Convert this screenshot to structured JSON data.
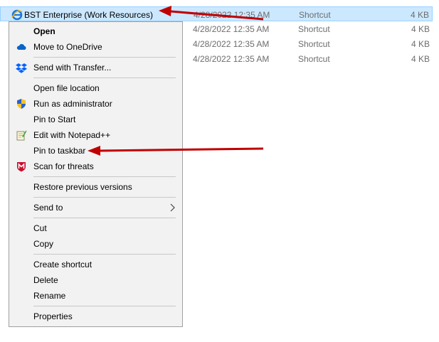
{
  "files": [
    {
      "name": "BST Enterprise (Work Resources)",
      "date": "4/28/2022 12:35 AM",
      "type": "Shortcut",
      "size": "4 KB"
    },
    {
      "name": "",
      "date": "4/28/2022 12:35 AM",
      "type": "Shortcut",
      "size": "4 KB"
    },
    {
      "name": "",
      "date": "4/28/2022 12:35 AM",
      "type": "Shortcut",
      "size": "4 KB"
    },
    {
      "name": "",
      "date": "4/28/2022 12:35 AM",
      "type": "Shortcut",
      "size": "4 KB"
    }
  ],
  "menu": {
    "open": "Open",
    "move_onedrive": "Move to OneDrive",
    "send_transfer": "Send with Transfer...",
    "open_location": "Open file location",
    "run_admin": "Run as administrator",
    "pin_start": "Pin to Start",
    "edit_notepad": "Edit with Notepad++",
    "pin_taskbar": "Pin to taskbar",
    "scan_threats": "Scan for threats",
    "restore_versions": "Restore previous versions",
    "send_to": "Send to",
    "cut": "Cut",
    "copy": "Copy",
    "create_shortcut": "Create shortcut",
    "delete": "Delete",
    "rename": "Rename",
    "properties": "Properties"
  },
  "colors": {
    "selection": "#cce8ff",
    "arrow": "#c00000",
    "menu_bg": "#f2f2f2"
  },
  "icons": {
    "file": "ie-shortcut-icon",
    "onedrive": "cloud-icon",
    "transfer": "dropbox-icon",
    "admin": "uac-shield-icon",
    "notepad": "notepad-icon",
    "scan": "mcafee-shield-icon",
    "sendto": "chevron-right-icon"
  }
}
